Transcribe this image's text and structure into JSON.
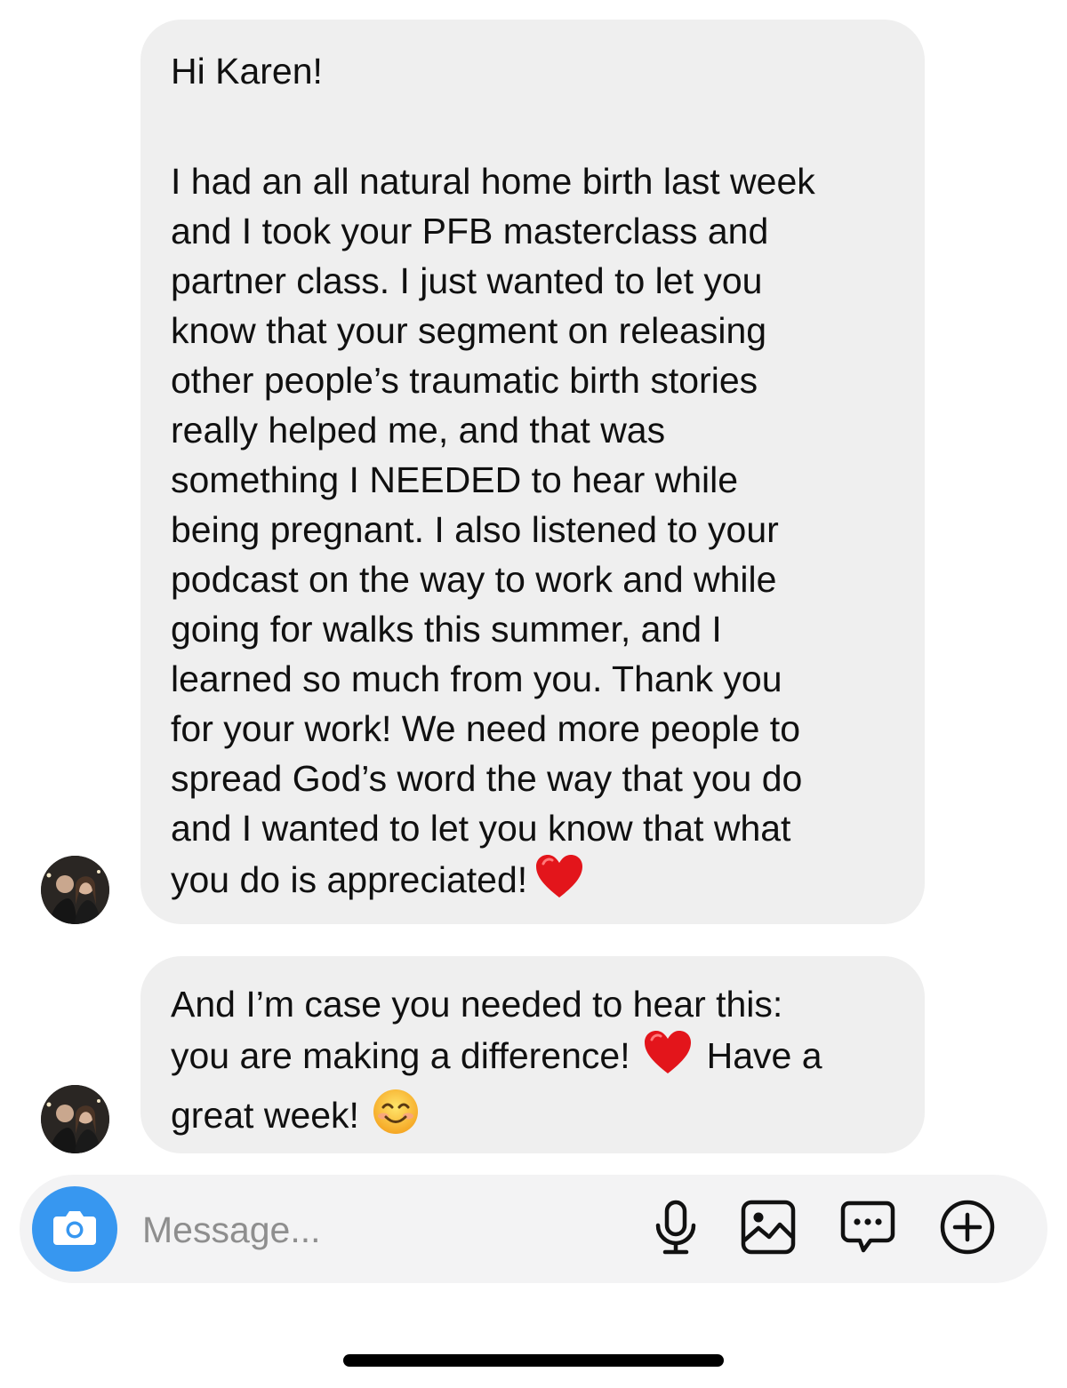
{
  "messages": [
    {
      "lines": [
        "Hi Karen!",
        "",
        "I had an all natural home birth last week",
        "and I took your PFB masterclass and",
        "partner class. I just wanted to let you",
        "know that your segment on releasing",
        "other people’s traumatic birth stories",
        "really helped me, and that was",
        "something I NEEDED to hear while",
        "being pregnant. I also listened to your",
        "podcast on the way to work and while",
        "going for walks this summer, and I",
        "learned so much from you. Thank you",
        "for your work! We need more people to",
        "spread God’s word the way that you do",
        "and I wanted to let you know that what",
        "you do is appreciated!"
      ],
      "end_emoji": "red-heart"
    },
    {
      "line1": "And I’m case you needed to hear this:",
      "line2_before": "you are making a difference!",
      "line2_emoji": "red-heart",
      "line2_after": "Have a",
      "line3": "great week!",
      "line3_emoji": "smiling-face"
    }
  ],
  "composer": {
    "placeholder": "Message...",
    "icons": [
      "camera-icon",
      "microphone-icon",
      "gallery-icon",
      "chat-bubble-icon",
      "plus-circle-icon"
    ],
    "camera_color": "#3797f0"
  },
  "colors": {
    "bubble": "#efefef",
    "composer": "#f3f3f4"
  }
}
